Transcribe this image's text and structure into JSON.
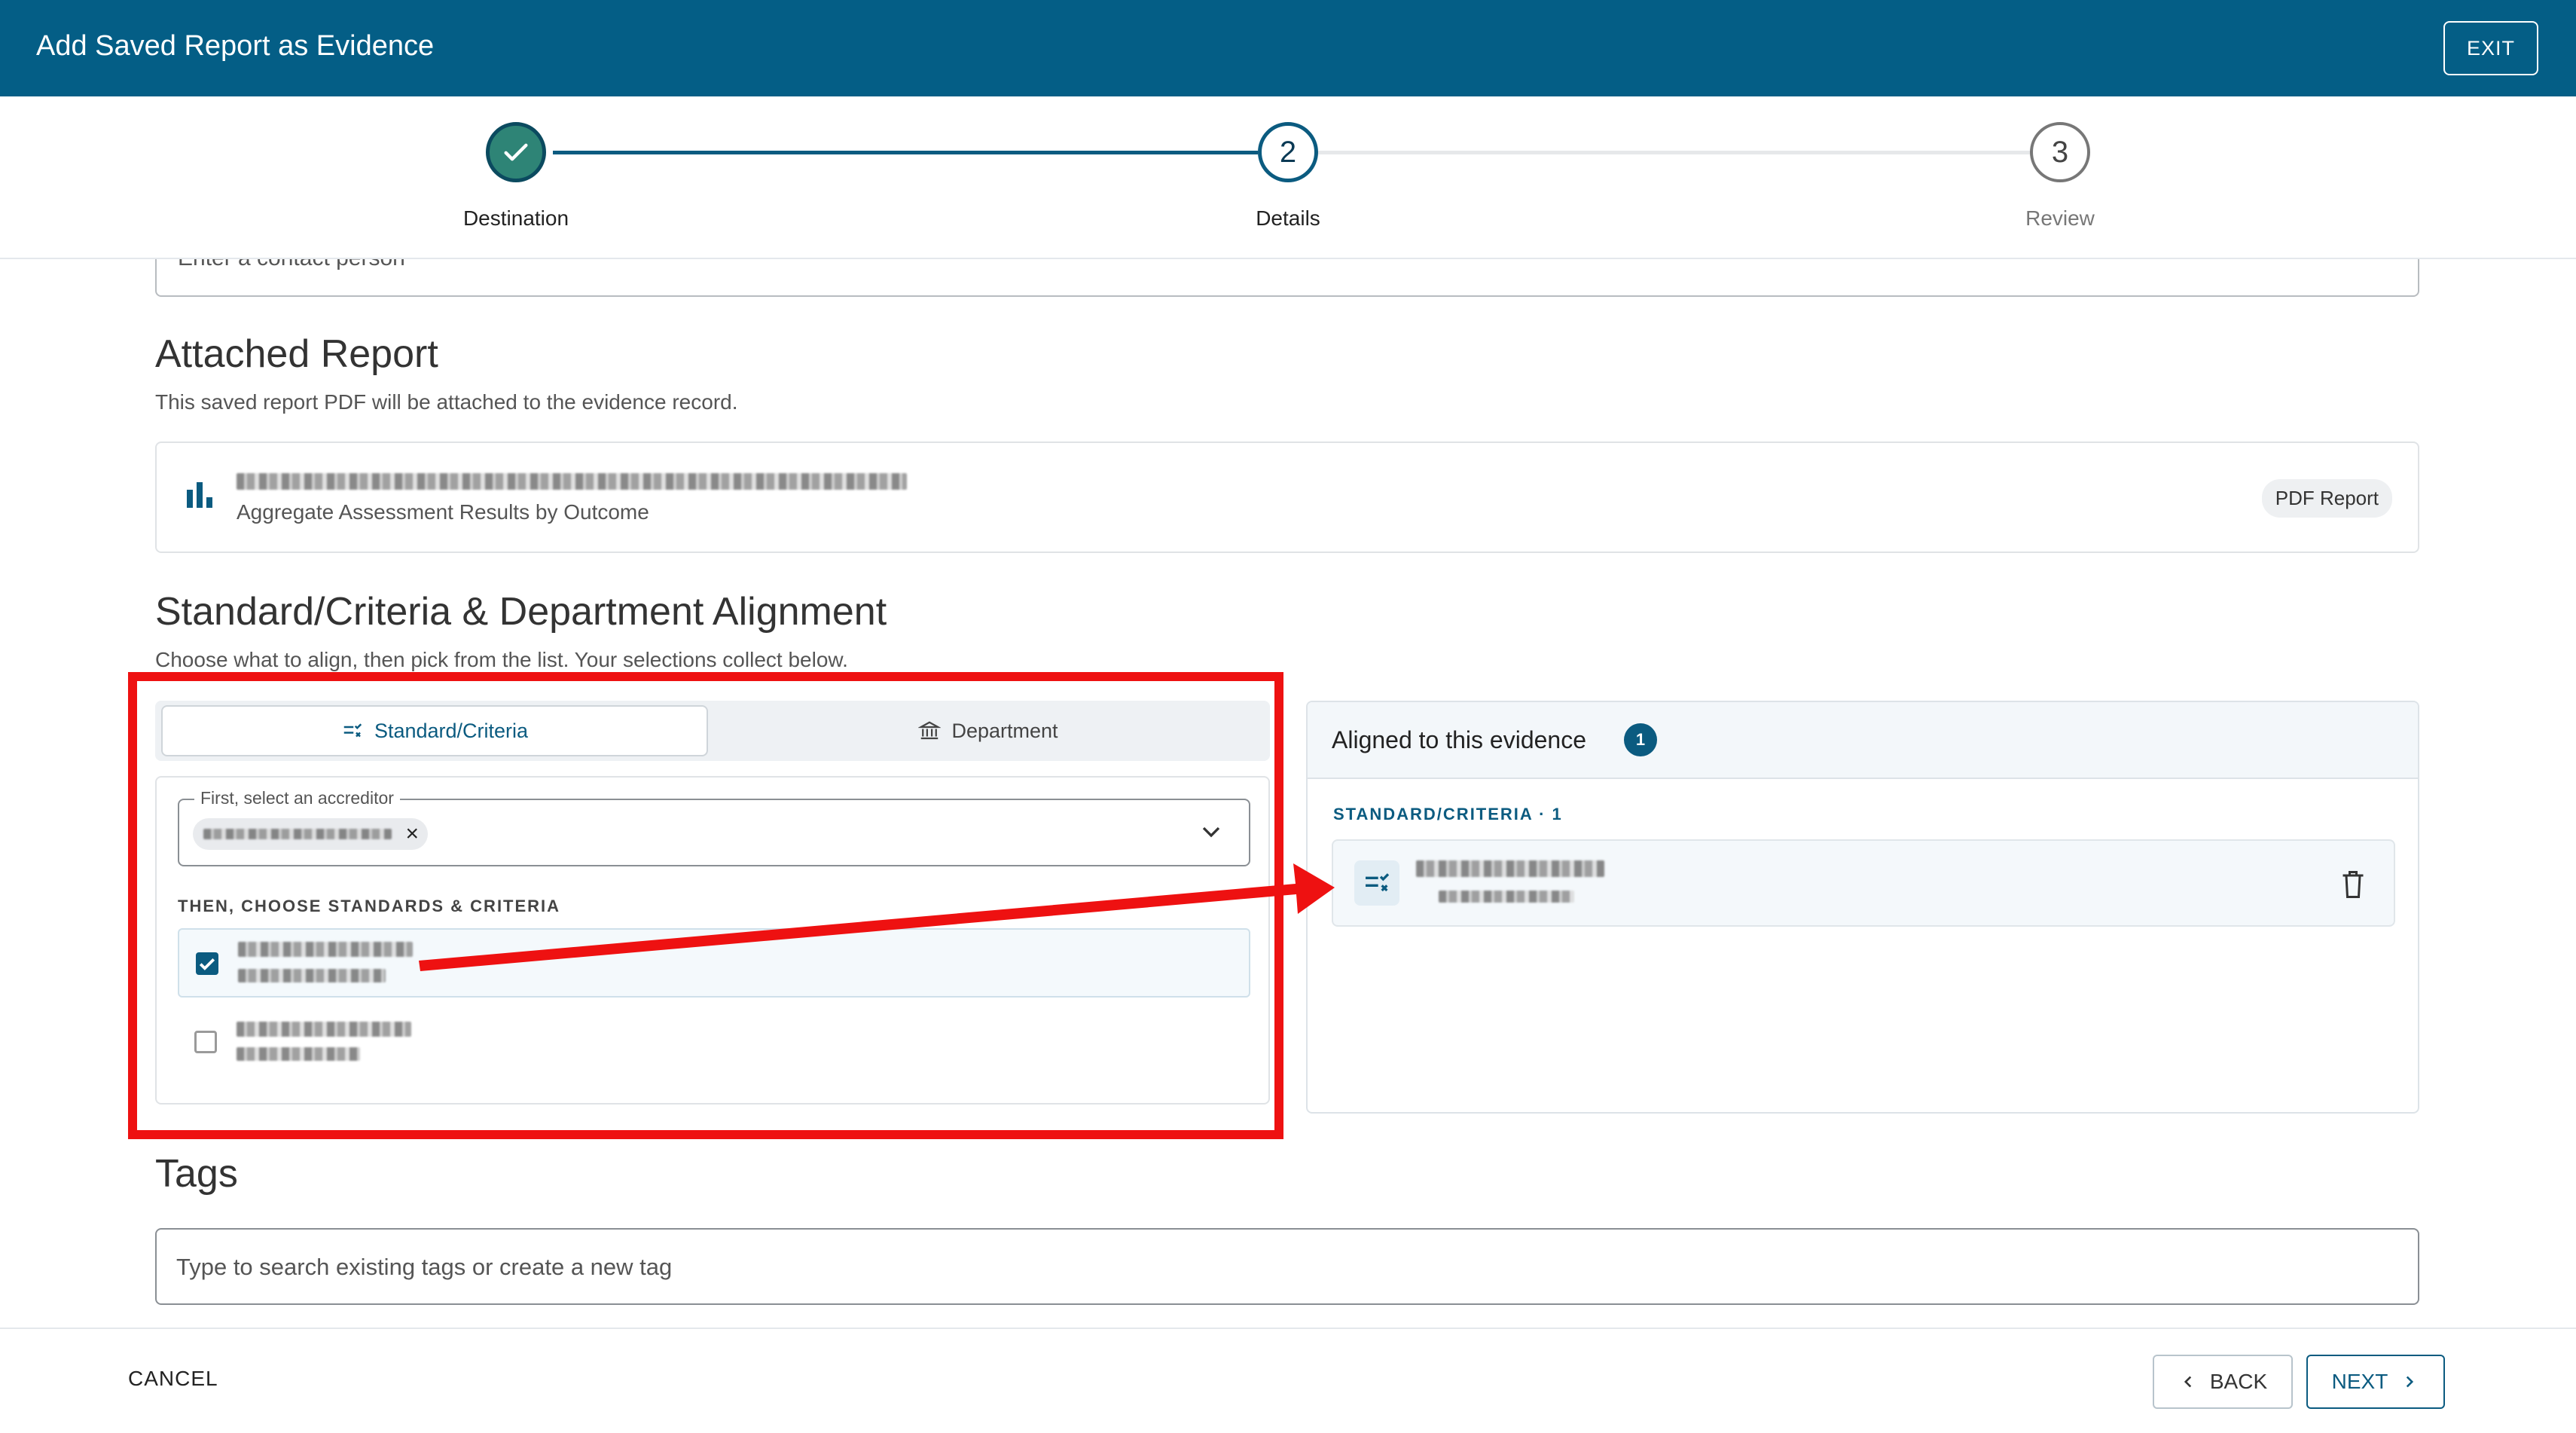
{
  "header": {
    "title": "Add Saved Report as Evidence",
    "exit_label": "EXIT"
  },
  "stepper": {
    "steps": [
      {
        "number": "1",
        "label": "Destination",
        "status": "complete"
      },
      {
        "number": "2",
        "label": "Details",
        "status": "current"
      },
      {
        "number": "3",
        "label": "Review",
        "status": "upcoming"
      }
    ]
  },
  "contact": {
    "placeholder": "Enter a contact person"
  },
  "attached_report": {
    "title": "Attached Report",
    "subtitle": "This saved report PDF will be attached to the evidence record.",
    "report_type": "Aggregate Assessment Results by Outcome",
    "badge": "PDF Report",
    "icon": "bar-chart-icon"
  },
  "alignment": {
    "title": "Standard/Criteria & Department Alignment",
    "subtitle": "Choose what to align, then pick from the list. Your selections collect below.",
    "tabs": [
      {
        "label": "Standard/Criteria",
        "icon": "standards-icon",
        "active": true
      },
      {
        "label": "Department",
        "icon": "building-icon",
        "active": false
      }
    ],
    "accreditor_label": "First, select an accreditor",
    "choose_label": "THEN, CHOOSE STANDARDS & CRITERIA",
    "options": [
      {
        "checked": true
      },
      {
        "checked": false
      }
    ],
    "aligned": {
      "title": "Aligned to this evidence",
      "count": "1",
      "group_label": "STANDARD/CRITERIA · 1"
    }
  },
  "tags": {
    "title": "Tags",
    "placeholder": "Type to search existing tags or create a new tag"
  },
  "footer": {
    "cancel_label": "CANCEL",
    "back_label": "BACK",
    "next_label": "NEXT"
  },
  "colors": {
    "primary": "#045e86",
    "complete": "#2e8476",
    "annotation": "#ee1111"
  }
}
